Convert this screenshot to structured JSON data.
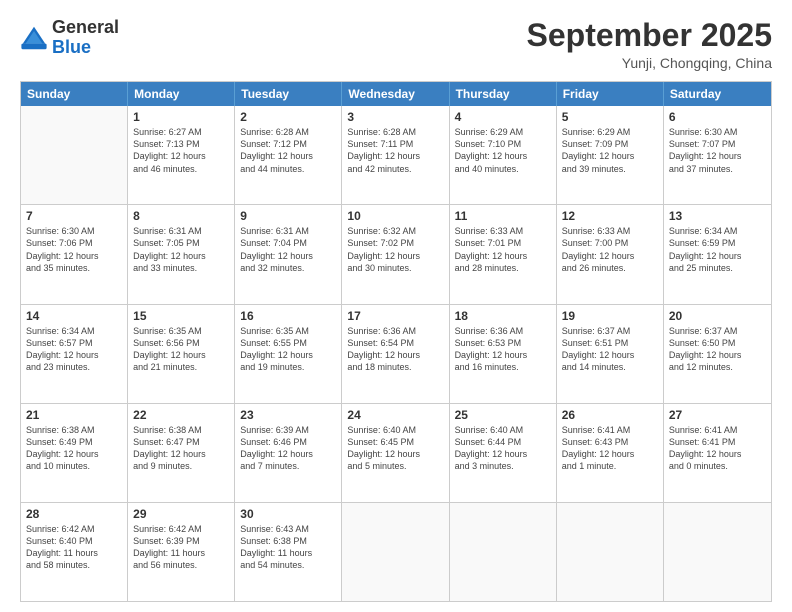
{
  "header": {
    "logo_general": "General",
    "logo_blue": "Blue",
    "month_title": "September 2025",
    "subtitle": "Yunji, Chongqing, China"
  },
  "weekdays": [
    "Sunday",
    "Monday",
    "Tuesday",
    "Wednesday",
    "Thursday",
    "Friday",
    "Saturday"
  ],
  "rows": [
    [
      {
        "day": "",
        "lines": []
      },
      {
        "day": "1",
        "lines": [
          "Sunrise: 6:27 AM",
          "Sunset: 7:13 PM",
          "Daylight: 12 hours",
          "and 46 minutes."
        ]
      },
      {
        "day": "2",
        "lines": [
          "Sunrise: 6:28 AM",
          "Sunset: 7:12 PM",
          "Daylight: 12 hours",
          "and 44 minutes."
        ]
      },
      {
        "day": "3",
        "lines": [
          "Sunrise: 6:28 AM",
          "Sunset: 7:11 PM",
          "Daylight: 12 hours",
          "and 42 minutes."
        ]
      },
      {
        "day": "4",
        "lines": [
          "Sunrise: 6:29 AM",
          "Sunset: 7:10 PM",
          "Daylight: 12 hours",
          "and 40 minutes."
        ]
      },
      {
        "day": "5",
        "lines": [
          "Sunrise: 6:29 AM",
          "Sunset: 7:09 PM",
          "Daylight: 12 hours",
          "and 39 minutes."
        ]
      },
      {
        "day": "6",
        "lines": [
          "Sunrise: 6:30 AM",
          "Sunset: 7:07 PM",
          "Daylight: 12 hours",
          "and 37 minutes."
        ]
      }
    ],
    [
      {
        "day": "7",
        "lines": [
          "Sunrise: 6:30 AM",
          "Sunset: 7:06 PM",
          "Daylight: 12 hours",
          "and 35 minutes."
        ]
      },
      {
        "day": "8",
        "lines": [
          "Sunrise: 6:31 AM",
          "Sunset: 7:05 PM",
          "Daylight: 12 hours",
          "and 33 minutes."
        ]
      },
      {
        "day": "9",
        "lines": [
          "Sunrise: 6:31 AM",
          "Sunset: 7:04 PM",
          "Daylight: 12 hours",
          "and 32 minutes."
        ]
      },
      {
        "day": "10",
        "lines": [
          "Sunrise: 6:32 AM",
          "Sunset: 7:02 PM",
          "Daylight: 12 hours",
          "and 30 minutes."
        ]
      },
      {
        "day": "11",
        "lines": [
          "Sunrise: 6:33 AM",
          "Sunset: 7:01 PM",
          "Daylight: 12 hours",
          "and 28 minutes."
        ]
      },
      {
        "day": "12",
        "lines": [
          "Sunrise: 6:33 AM",
          "Sunset: 7:00 PM",
          "Daylight: 12 hours",
          "and 26 minutes."
        ]
      },
      {
        "day": "13",
        "lines": [
          "Sunrise: 6:34 AM",
          "Sunset: 6:59 PM",
          "Daylight: 12 hours",
          "and 25 minutes."
        ]
      }
    ],
    [
      {
        "day": "14",
        "lines": [
          "Sunrise: 6:34 AM",
          "Sunset: 6:57 PM",
          "Daylight: 12 hours",
          "and 23 minutes."
        ]
      },
      {
        "day": "15",
        "lines": [
          "Sunrise: 6:35 AM",
          "Sunset: 6:56 PM",
          "Daylight: 12 hours",
          "and 21 minutes."
        ]
      },
      {
        "day": "16",
        "lines": [
          "Sunrise: 6:35 AM",
          "Sunset: 6:55 PM",
          "Daylight: 12 hours",
          "and 19 minutes."
        ]
      },
      {
        "day": "17",
        "lines": [
          "Sunrise: 6:36 AM",
          "Sunset: 6:54 PM",
          "Daylight: 12 hours",
          "and 18 minutes."
        ]
      },
      {
        "day": "18",
        "lines": [
          "Sunrise: 6:36 AM",
          "Sunset: 6:53 PM",
          "Daylight: 12 hours",
          "and 16 minutes."
        ]
      },
      {
        "day": "19",
        "lines": [
          "Sunrise: 6:37 AM",
          "Sunset: 6:51 PM",
          "Daylight: 12 hours",
          "and 14 minutes."
        ]
      },
      {
        "day": "20",
        "lines": [
          "Sunrise: 6:37 AM",
          "Sunset: 6:50 PM",
          "Daylight: 12 hours",
          "and 12 minutes."
        ]
      }
    ],
    [
      {
        "day": "21",
        "lines": [
          "Sunrise: 6:38 AM",
          "Sunset: 6:49 PM",
          "Daylight: 12 hours",
          "and 10 minutes."
        ]
      },
      {
        "day": "22",
        "lines": [
          "Sunrise: 6:38 AM",
          "Sunset: 6:47 PM",
          "Daylight: 12 hours",
          "and 9 minutes."
        ]
      },
      {
        "day": "23",
        "lines": [
          "Sunrise: 6:39 AM",
          "Sunset: 6:46 PM",
          "Daylight: 12 hours",
          "and 7 minutes."
        ]
      },
      {
        "day": "24",
        "lines": [
          "Sunrise: 6:40 AM",
          "Sunset: 6:45 PM",
          "Daylight: 12 hours",
          "and 5 minutes."
        ]
      },
      {
        "day": "25",
        "lines": [
          "Sunrise: 6:40 AM",
          "Sunset: 6:44 PM",
          "Daylight: 12 hours",
          "and 3 minutes."
        ]
      },
      {
        "day": "26",
        "lines": [
          "Sunrise: 6:41 AM",
          "Sunset: 6:43 PM",
          "Daylight: 12 hours",
          "and 1 minute."
        ]
      },
      {
        "day": "27",
        "lines": [
          "Sunrise: 6:41 AM",
          "Sunset: 6:41 PM",
          "Daylight: 12 hours",
          "and 0 minutes."
        ]
      }
    ],
    [
      {
        "day": "28",
        "lines": [
          "Sunrise: 6:42 AM",
          "Sunset: 6:40 PM",
          "Daylight: 11 hours",
          "and 58 minutes."
        ]
      },
      {
        "day": "29",
        "lines": [
          "Sunrise: 6:42 AM",
          "Sunset: 6:39 PM",
          "Daylight: 11 hours",
          "and 56 minutes."
        ]
      },
      {
        "day": "30",
        "lines": [
          "Sunrise: 6:43 AM",
          "Sunset: 6:38 PM",
          "Daylight: 11 hours",
          "and 54 minutes."
        ]
      },
      {
        "day": "",
        "lines": []
      },
      {
        "day": "",
        "lines": []
      },
      {
        "day": "",
        "lines": []
      },
      {
        "day": "",
        "lines": []
      }
    ]
  ]
}
